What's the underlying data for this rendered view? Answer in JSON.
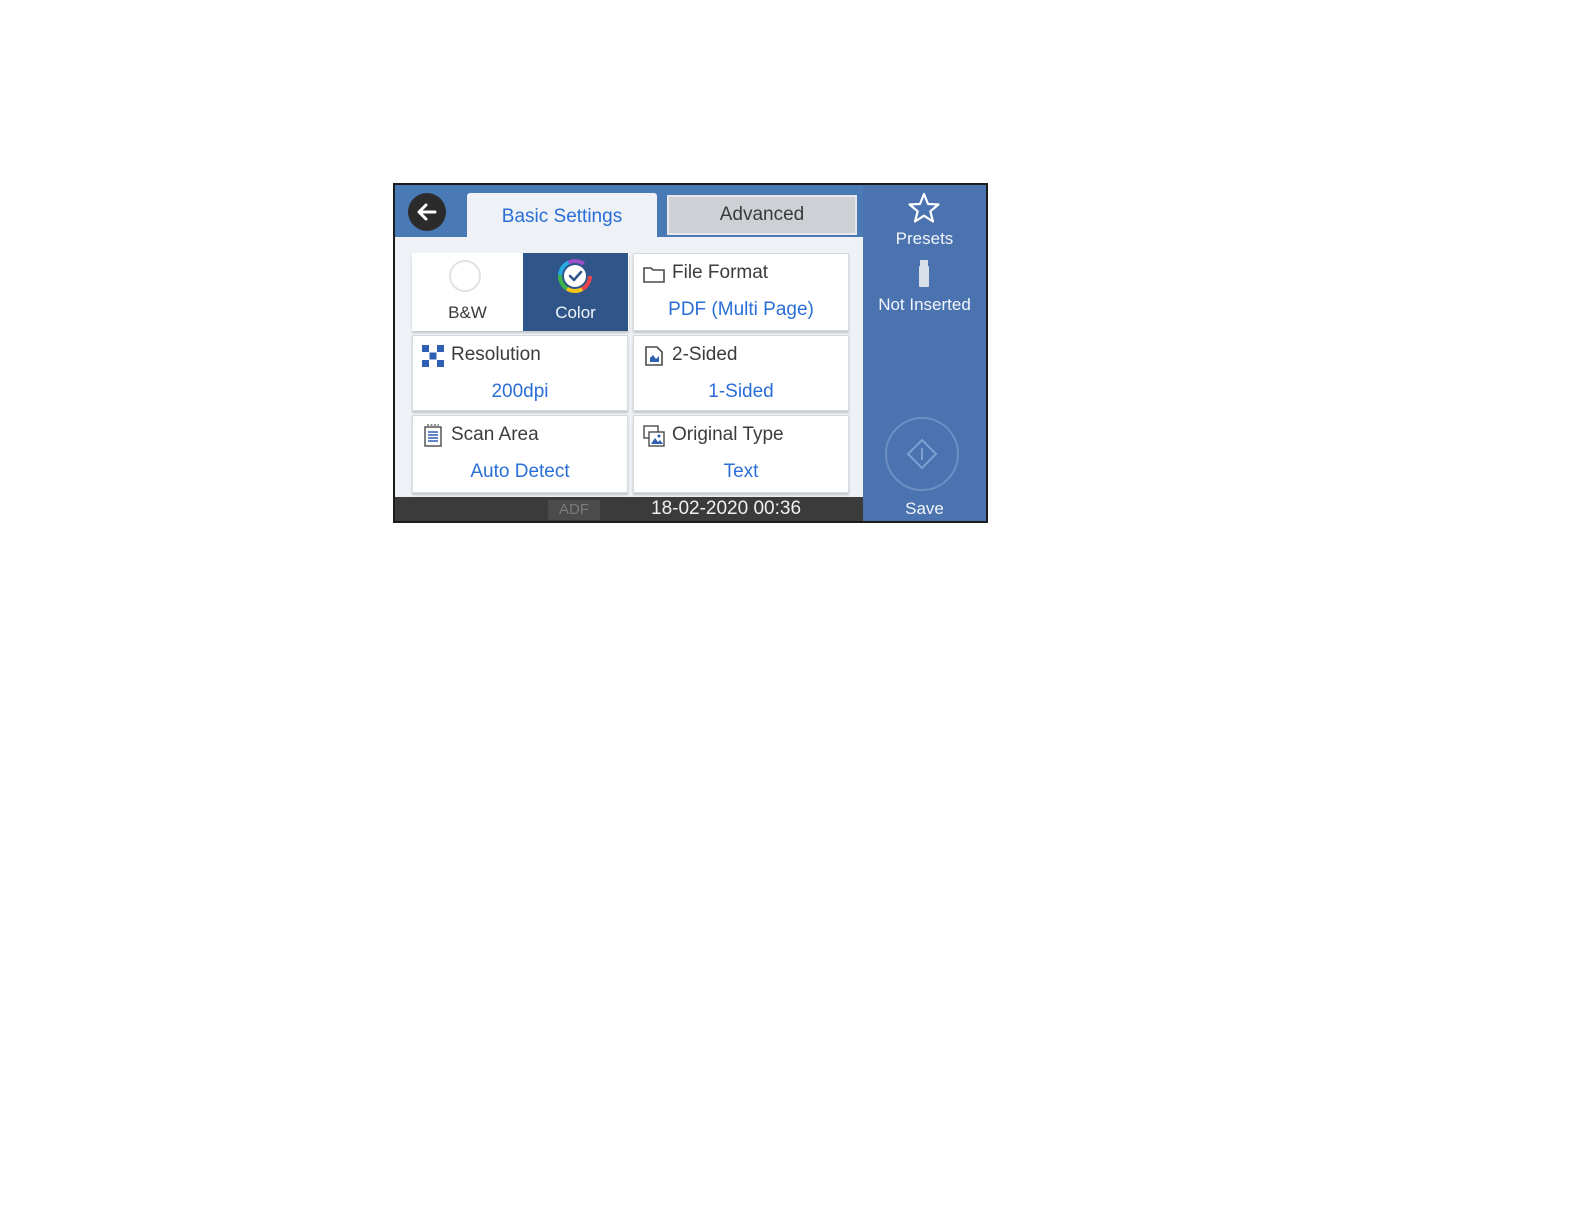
{
  "tabs": [
    {
      "label": "Basic Settings",
      "active": true
    },
    {
      "label": "Advanced",
      "active": false
    }
  ],
  "color_mode": {
    "bw_label": "B&W",
    "color_label": "Color",
    "selected": "Color"
  },
  "settings": {
    "file_format": {
      "title": "File Format",
      "value": "PDF (Multi Page)"
    },
    "resolution": {
      "title": "Resolution",
      "value": "200dpi"
    },
    "two_sided": {
      "title": "2-Sided",
      "value": "1-Sided"
    },
    "scan_area": {
      "title": "Scan Area",
      "value": "Auto Detect"
    },
    "original_type": {
      "title": "Original Type",
      "value": "Text"
    }
  },
  "status_bar": {
    "adf_label": "ADF",
    "datetime": "18-02-2020 00:36"
  },
  "side_panel": {
    "presets_label": "Presets",
    "memory_status": "Not Inserted",
    "save_label": "Save"
  },
  "colors": {
    "accent_blue": "#2a6ed8",
    "panel_blue": "#4a73b0",
    "selected_tile": "#2f5589"
  },
  "icons": [
    "back-arrow-icon",
    "radio-empty-icon",
    "color-check-icon",
    "folder-icon",
    "resolution-grid-icon",
    "two-sided-icon",
    "scan-area-icon",
    "original-type-icon",
    "star-icon",
    "usb-drive-icon",
    "start-diamond-icon"
  ]
}
